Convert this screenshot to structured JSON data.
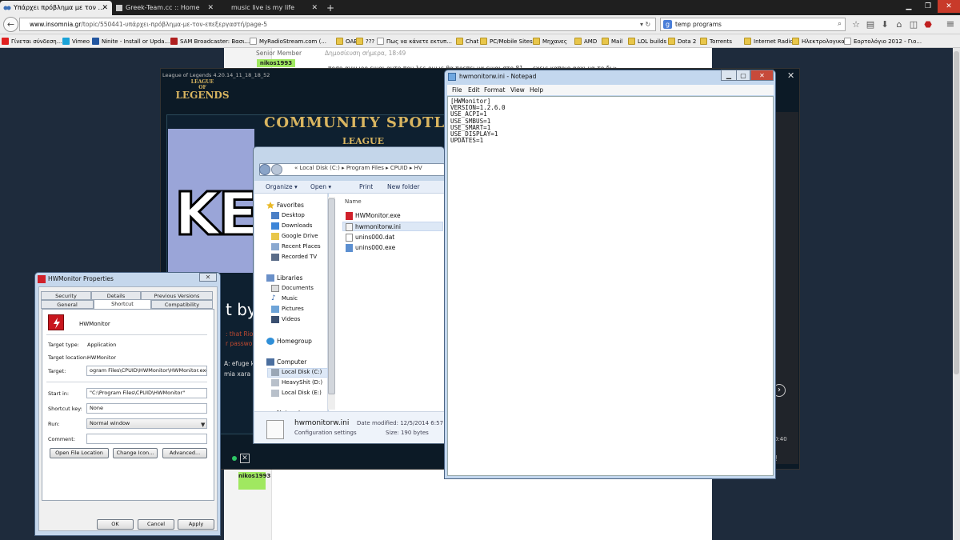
{
  "browser": {
    "tabs": [
      {
        "label": "Υπάρχει πρόβλημα με τον ...",
        "active": true
      },
      {
        "label": "Greek-Team.cc :: Home",
        "active": false
      },
      {
        "label": "music live is my life",
        "active": false
      }
    ],
    "url_host": "www.insomnia.gr",
    "url_path": "/topic/550441-υπάρχει-πρόβλημα-με-τον-επεξεργαστή/page-5",
    "search_value": "temp programs",
    "search_engine_letter": "g"
  },
  "bookmarks": [
    {
      "label": "Γίνεται σύνδεση...",
      "icon": "yt"
    },
    {
      "label": "Vimeo",
      "icon": "vm"
    },
    {
      "label": "Ninite - Install or Upda...",
      "icon": "ni"
    },
    {
      "label": "SAM Broadcaster: Βασι...",
      "icon": "sam"
    },
    {
      "label": "MyRadioStream.com (...",
      "icon": "blank"
    },
    {
      "label": "ΟΑΕΔ",
      "icon": "folder"
    },
    {
      "label": "???",
      "icon": "folder"
    },
    {
      "label": "Πως να κάνετε εκτυπ...",
      "icon": "pg"
    },
    {
      "label": "Chat",
      "icon": "folder"
    },
    {
      "label": "PC/Mobile Sites",
      "icon": "folder"
    },
    {
      "label": "Μηχανες",
      "icon": "folder"
    },
    {
      "label": "AMD",
      "icon": "folder"
    },
    {
      "label": "Mail",
      "icon": "folder"
    },
    {
      "label": "LOL builds",
      "icon": "folder"
    },
    {
      "label": "Dota 2",
      "icon": "folder"
    },
    {
      "label": "Torrents",
      "icon": "folder"
    },
    {
      "label": "Internet Radio",
      "icon": "folder"
    },
    {
      "label": "Ηλεκτρολογικα",
      "icon": "folder"
    },
    {
      "label": "Εορτολόγιο 2012 - Γιο...",
      "icon": "blank"
    }
  ],
  "forum": {
    "rank": "Senior Member",
    "posted": "Δημοσίευση σήμερα, 18:49",
    "post_text": "ποσο αγνωρο ειναι αυτο που λες ομως θα πρεπει να ειναι στο 81 ... εχεις καποιο αρχι να το δω;",
    "avatar_text": "nikos1993",
    "avatar_text_2": "nikos1993"
  },
  "lol": {
    "title": "League of Legends 4.20.14_11_18_18_52",
    "logo_top": "LEAGUE",
    "logo_sub": "OF",
    "logo_bottom": "LEGENDS",
    "spotlight": "COMMUNITY SPOTLI",
    "brand": "LEAGUE",
    "key": "KEY",
    "by_text": "t by t",
    "red1": ": that Rio",
    "red2": "r passwo",
    "chat1": "A: efuge k e",
    "chat2": "mia xara",
    "time": "0:40"
  },
  "explorer": {
    "path": [
      "Local Disk (C:)",
      "Program Files",
      "CPUID",
      "HV"
    ],
    "toolbar": {
      "organize": "Organize ▾",
      "open": "Open ▾",
      "print": "Print",
      "new_folder": "New folder"
    },
    "column_name": "Name",
    "nav": {
      "favorites": "Favorites",
      "fav_items": [
        "Desktop",
        "Downloads",
        "Google Drive",
        "Recent Places",
        "Recorded TV"
      ],
      "libraries": "Libraries",
      "lib_items": [
        "Documents",
        "Music",
        "Pictures",
        "Videos"
      ],
      "homegroup": "Homegroup",
      "computer": "Computer",
      "comp_items": [
        "Local Disk (C:)",
        "HeavyShit (D:)",
        "Local Disk (E:)"
      ],
      "network": "Network"
    },
    "files": [
      "HWMonitor.exe",
      "hwmonitorw.ini",
      "unins000.dat",
      "unins000.exe"
    ],
    "detail": {
      "name": "hwmonitorw.ini",
      "type": "Configuration settings",
      "modified": "Date modified: 12/5/2014 6:57 PM",
      "size": "Size: 190 bytes"
    }
  },
  "notepad": {
    "title": "hwmonitorw.ini - Notepad",
    "menu": [
      "File",
      "Edit",
      "Format",
      "View",
      "Help"
    ],
    "content": "[HWMonitor]\nVERSION=1.2.6.0\nUSE_ACPI=1\nUSE_SMBUS=1\nUSE_SMART=1\nUSE_DISPLAY=1\nUPDATES=1"
  },
  "properties": {
    "title": "HWMonitor Properties",
    "tabs_top": [
      "Security",
      "Details",
      "Previous Versions"
    ],
    "tabs_bottom": [
      "General",
      "Shortcut",
      "Compatibility"
    ],
    "app_name": "HWMonitor",
    "target_type_label": "Target type:",
    "target_type": "Application",
    "target_location_label": "Target location:",
    "target_location": "HWMonitor",
    "target_label": "Target:",
    "target": "ogram Files\\CPUID\\HWMonitor\\HWMonitor.exe\"",
    "start_in_label": "Start in:",
    "start_in": "\"C:\\Program Files\\CPUID\\HWMonitor\"",
    "shortcut_key_label": "Shortcut key:",
    "shortcut_key": "None",
    "run_label": "Run:",
    "run": "Normal window",
    "comment_label": "Comment:",
    "comment": "",
    "buttons": {
      "open_location": "Open File Location",
      "change_icon": "Change Icon...",
      "advanced": "Advanced..."
    },
    "footer": {
      "ok": "OK",
      "cancel": "Cancel",
      "apply": "Apply"
    }
  }
}
